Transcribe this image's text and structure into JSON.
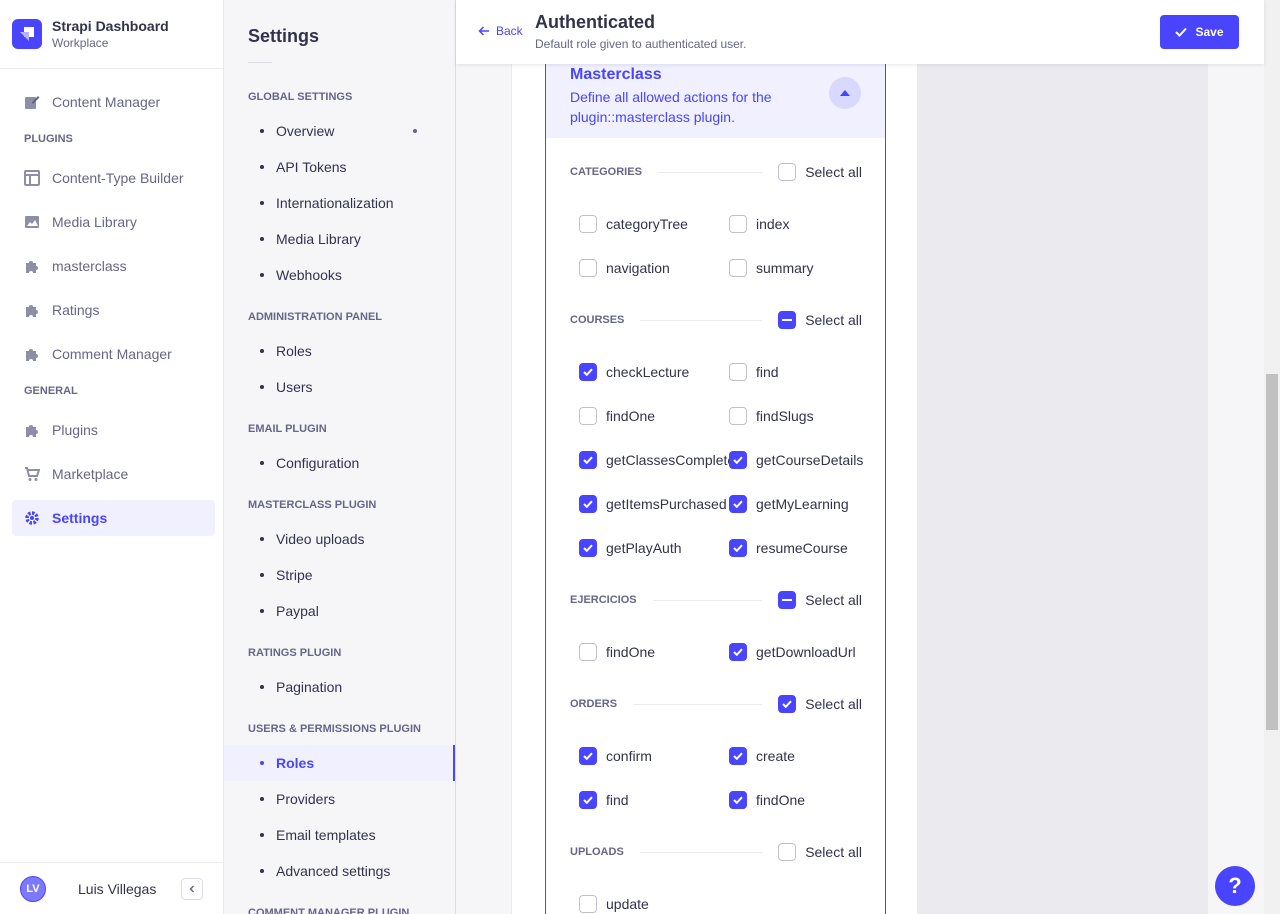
{
  "brand": {
    "title": "Strapi Dashboard",
    "subtitle": "Workplace"
  },
  "leftnav": {
    "content_manager": "Content Manager",
    "plugins_section": "PLUGINS",
    "plugins": [
      "Content-Type Builder",
      "Media Library",
      "masterclass",
      "Ratings",
      "Comment Manager"
    ],
    "general_section": "GENERAL",
    "general": [
      "Plugins",
      "Marketplace",
      "Settings"
    ],
    "active": "Settings"
  },
  "user": {
    "initials": "LV",
    "name": "Luis Villegas"
  },
  "settings": {
    "title": "Settings",
    "sections": [
      {
        "label": "GLOBAL SETTINGS",
        "items": [
          "Overview",
          "API Tokens",
          "Internationalization",
          "Media Library",
          "Webhooks"
        ]
      },
      {
        "label": "ADMINISTRATION PANEL",
        "items": [
          "Roles",
          "Users"
        ]
      },
      {
        "label": "EMAIL PLUGIN",
        "items": [
          "Configuration"
        ]
      },
      {
        "label": "MASTERCLASS PLUGIN",
        "items": [
          "Video uploads",
          "Stripe",
          "Paypal"
        ]
      },
      {
        "label": "RATINGS PLUGIN",
        "items": [
          "Pagination"
        ]
      },
      {
        "label": "USERS & PERMISSIONS PLUGIN",
        "items": [
          "Roles",
          "Providers",
          "Email templates",
          "Advanced settings"
        ]
      },
      {
        "label": "COMMENT MANAGER PLUGIN",
        "items": []
      }
    ],
    "active_item": "Roles"
  },
  "header": {
    "back": "Back",
    "title": "Authenticated",
    "subtitle": "Default role given to authenticated user.",
    "save": "Save"
  },
  "plugin_panel": {
    "name": "Masterclass",
    "description": "Define all allowed actions for the plugin::masterclass plugin.",
    "select_all_label": "Select all",
    "groups": [
      {
        "label": "CATEGORIES",
        "select_all": "unchecked",
        "actions": [
          {
            "name": "categoryTree",
            "checked": false
          },
          {
            "name": "index",
            "checked": false
          },
          {
            "name": "navigation",
            "checked": false
          },
          {
            "name": "summary",
            "checked": false
          }
        ]
      },
      {
        "label": "COURSES",
        "select_all": "indeterminate",
        "actions": [
          {
            "name": "checkLecture",
            "checked": true
          },
          {
            "name": "find",
            "checked": false
          },
          {
            "name": "findOne",
            "checked": false
          },
          {
            "name": "findSlugs",
            "checked": false
          },
          {
            "name": "getClassesComplete",
            "checked": true
          },
          {
            "name": "getCourseDetails",
            "checked": true
          },
          {
            "name": "getItemsPurchased",
            "checked": true
          },
          {
            "name": "getMyLearning",
            "checked": true
          },
          {
            "name": "getPlayAuth",
            "checked": true
          },
          {
            "name": "resumeCourse",
            "checked": true
          }
        ]
      },
      {
        "label": "EJERCICIOS",
        "select_all": "indeterminate",
        "actions": [
          {
            "name": "findOne",
            "checked": false
          },
          {
            "name": "getDownloadUrl",
            "checked": true
          }
        ]
      },
      {
        "label": "ORDERS",
        "select_all": "checked",
        "actions": [
          {
            "name": "confirm",
            "checked": true
          },
          {
            "name": "create",
            "checked": true
          },
          {
            "name": "find",
            "checked": true
          },
          {
            "name": "findOne",
            "checked": true
          }
        ]
      },
      {
        "label": "UPLOADS",
        "select_all": "unchecked",
        "actions": [
          {
            "name": "update",
            "checked": false
          }
        ]
      }
    ]
  },
  "help": {
    "label": "?"
  },
  "colors": {
    "accent": "#4945ff",
    "accent_light": "#f0f0ff",
    "text": "#32324d",
    "muted": "#666687"
  },
  "icons": [
    "logo-icon",
    "pencil-icon",
    "layout-icon",
    "image-icon",
    "puzzle-icon",
    "cart-icon",
    "gear-icon",
    "arrow-left-icon",
    "check-icon",
    "chevron-up-icon",
    "chevron-left-icon"
  ]
}
